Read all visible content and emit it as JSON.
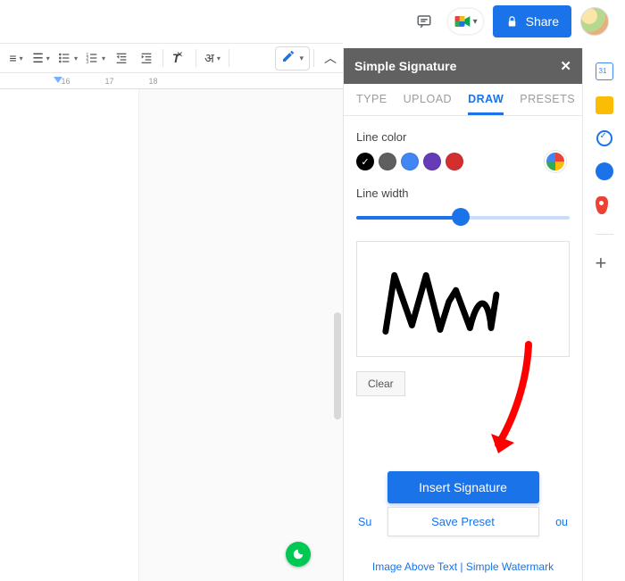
{
  "header": {
    "share_label": "Share"
  },
  "toolbar": {
    "align_icon": "≡",
    "linespacing_icon": "☰",
    "bulleted_icon": "• –",
    "numbered_icon": "1–",
    "indent_dec_icon": "⇤",
    "indent_inc_icon": "⇥",
    "clear_format_icon": "X̶",
    "script_label": "अ",
    "pen_label": "✎",
    "collapse_icon": "︿"
  },
  "ruler": {
    "ticks": [
      "",
      "16",
      "17",
      "18"
    ]
  },
  "panel": {
    "title": "Simple Signature",
    "tabs": [
      "TYPE",
      "UPLOAD",
      "DRAW",
      "PRESETS"
    ],
    "active_tab": "DRAW",
    "line_color_label": "Line color",
    "colors": [
      {
        "hex": "#000000",
        "selected": true
      },
      {
        "hex": "#5f5f5f",
        "selected": false
      },
      {
        "hex": "#4285f4",
        "selected": false
      },
      {
        "hex": "#673ab7",
        "selected": false
      },
      {
        "hex": "#d32f2f",
        "selected": false
      }
    ],
    "line_width_label": "Line width",
    "line_width_percent": 49,
    "clear_label": "Clear",
    "insert_label": "Insert Signature",
    "save_preset_label": "Save Preset",
    "support_left": "Su",
    "support_right": "ou",
    "footer_links": [
      "Image Above Text",
      "Simple Watermark"
    ],
    "footer_sep": " | "
  }
}
